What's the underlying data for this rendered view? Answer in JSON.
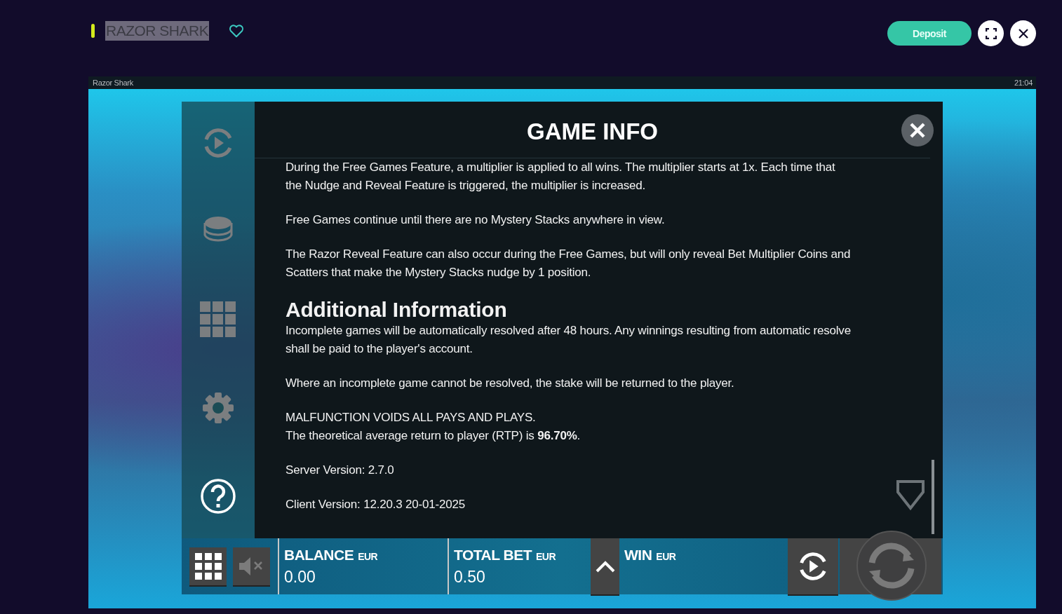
{
  "header": {
    "title": "RAZOR SHARK",
    "favorite": false,
    "deposit_label": "Deposit"
  },
  "game_bar": {
    "title": "Razor Shark",
    "time": "21:04"
  },
  "sidebar": [
    {
      "selected": false
    },
    {
      "selected": false
    },
    {
      "selected": false
    },
    {
      "selected": false
    },
    {
      "selected": true
    }
  ],
  "info": {
    "title": "GAME INFO",
    "paragraphs": [
      {
        "kind": "text",
        "text": "During the Free Games Feature, a multiplier is applied to all wins. The multiplier starts at 1x. Each time that the Nudge and Reveal Feature is triggered, the multiplier is increased."
      },
      {
        "kind": "text",
        "text": "Free Games continue until there are no Mystery Stacks anywhere in view."
      },
      {
        "kind": "text",
        "text": "The Razor Reveal Feature can also occur during the Free Games, but will only reveal Bet Multiplier Coins and Scatters that make the Mystery Stacks nudge by 1 position."
      },
      {
        "kind": "heading",
        "text": "Additional Information"
      },
      {
        "kind": "text",
        "text": "Incomplete games will be automatically resolved after 48 hours. Any winnings resulting from automatic resolve shall be paid to the player's account."
      },
      {
        "kind": "text",
        "text": "Where an incomplete game cannot be resolved, the stake will be returned to the player."
      },
      {
        "kind": "tight",
        "text": "MALFUNCTION VOIDS ALL PAYS AND PLAYS."
      },
      {
        "kind": "text",
        "text": "The theoretical average return to player (RTP) is **96.70%**."
      },
      {
        "kind": "text",
        "text": "Server Version: 2.7.0"
      },
      {
        "kind": "text",
        "text": "Client Version: 12.20.3 20-01-2025"
      }
    ]
  },
  "bottom_bar": {
    "muted": true,
    "balance": {
      "label": "BALANCE",
      "currency": "EUR",
      "value": "0.00"
    },
    "total_bet": {
      "label": "TOTAL BET",
      "currency": "EUR",
      "value": "0.50"
    },
    "win": {
      "label": "WIN",
      "currency": "EUR"
    }
  }
}
